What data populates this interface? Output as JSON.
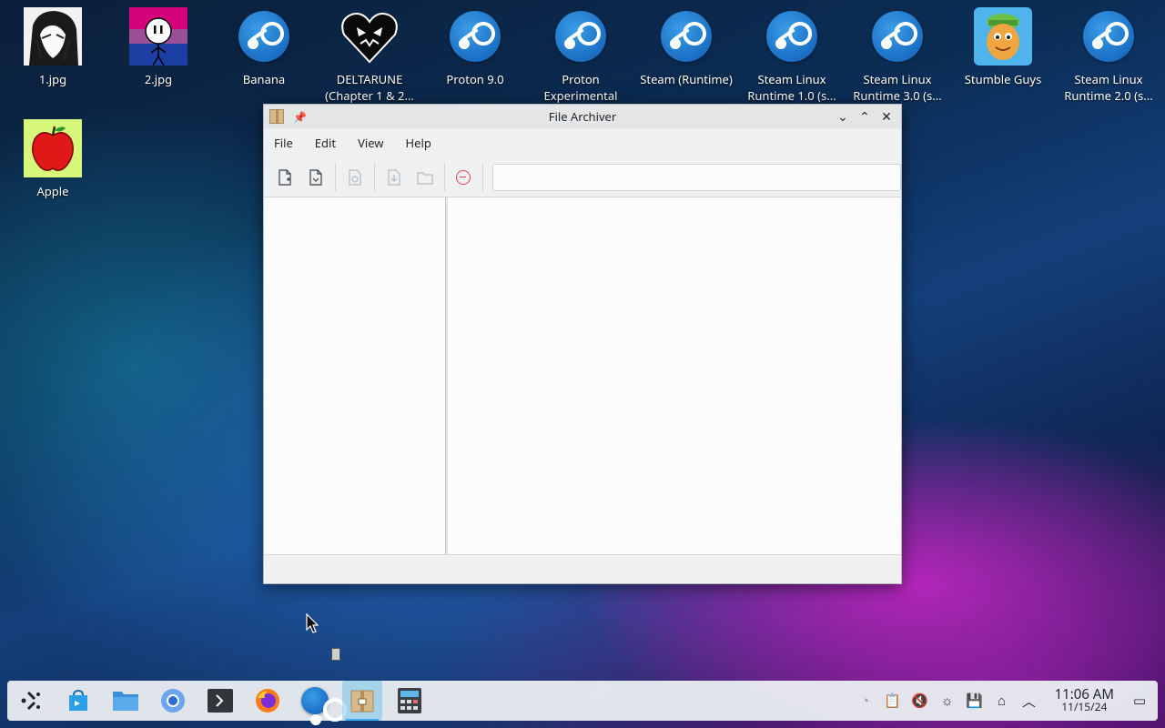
{
  "desktop": {
    "icons": [
      {
        "label": "1.jpg",
        "type": "image-manga"
      },
      {
        "label": "2.jpg",
        "type": "image-pink"
      },
      {
        "label": "Banana",
        "type": "steam"
      },
      {
        "label": "DELTARUNE\n(Chapter 1 & 2...",
        "type": "deltarune"
      },
      {
        "label": "Proton 9.0",
        "type": "steam"
      },
      {
        "label": "Proton\nExperimental",
        "type": "steam"
      },
      {
        "label": "Steam (Runtime)",
        "type": "steam"
      },
      {
        "label": "Steam Linux\nRuntime 1.0 (s...",
        "type": "steam"
      },
      {
        "label": "Steam Linux\nRuntime 3.0 (s...",
        "type": "steam"
      },
      {
        "label": "Stumble Guys",
        "type": "stumble"
      },
      {
        "label": "Steam Linux\nRuntime 2.0 (s...",
        "type": "steam"
      },
      {
        "label": "Apple",
        "type": "apple"
      }
    ]
  },
  "window": {
    "title": "File Archiver",
    "menu": [
      "File",
      "Edit",
      "View",
      "Help"
    ],
    "toolbar_icons": [
      "new-archive-icon",
      "open-archive-icon",
      "preview-icon",
      "extract-icon",
      "add-folder-icon",
      "stop-icon"
    ],
    "search_placeholder": ""
  },
  "taskbar": {
    "apps": [
      "application-launcher-icon",
      "discover-icon",
      "dolphin-icon",
      "chromium-icon",
      "konsole-icon",
      "firefox-icon",
      "steam-icon",
      "ark-icon",
      "calculator-icon"
    ],
    "active_app": "ark-icon",
    "clock_time": "11:06 AM",
    "clock_date": "11/15/24"
  },
  "colors": {
    "accent": "#3daee9",
    "stop": "#da4453",
    "steam": "#1b6fc4"
  }
}
